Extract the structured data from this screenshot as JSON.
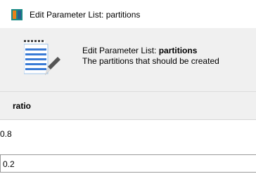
{
  "window": {
    "title": "Edit Parameter List: partitions"
  },
  "header": {
    "line1_prefix": "Edit Parameter List: ",
    "line1_bold": "partitions",
    "line2": "The partitions that should be created"
  },
  "table": {
    "columns": [
      "ratio"
    ],
    "rows": [
      {
        "ratio": "0.8"
      },
      {
        "ratio": "0.2"
      }
    ]
  },
  "colors": {
    "header_bg": "#f0f0f0",
    "icon_teal": "#1a8a86",
    "icon_orange": "#e8801a",
    "icon_blue": "#3a7bd5"
  }
}
